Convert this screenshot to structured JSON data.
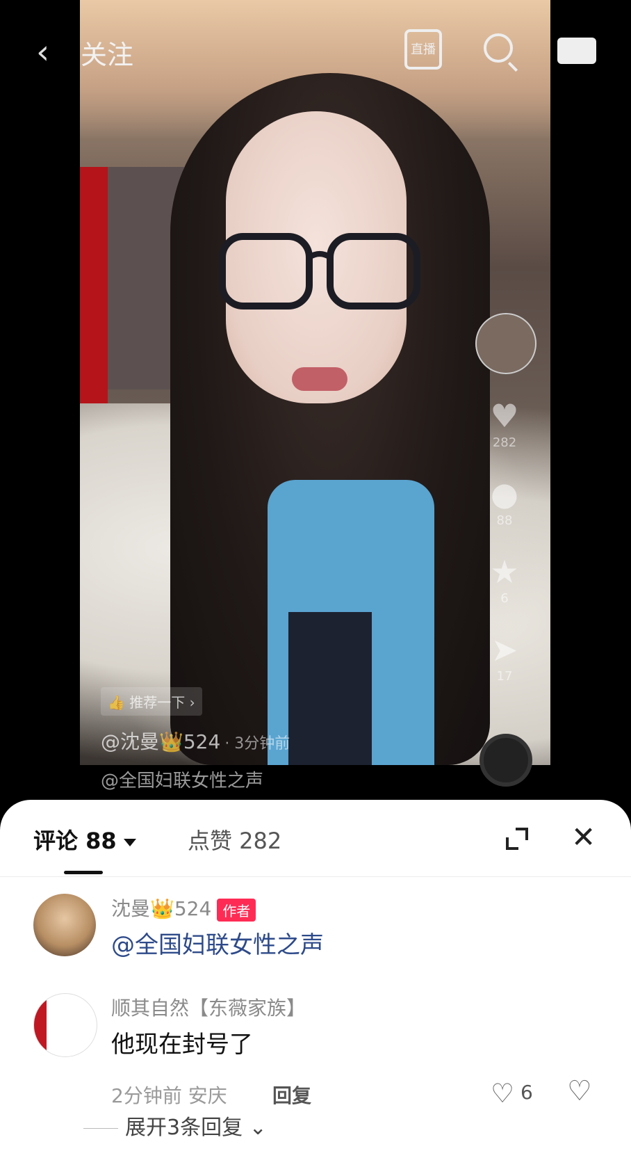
{
  "nav": {
    "follow_label": "关注",
    "live_label": "直播"
  },
  "video": {
    "recommend_label": "推荐一下",
    "author": "@沈曼👑524",
    "time": "· 3分钟前",
    "caption": "@全国妇联女性之声",
    "likes": "282",
    "comments": "88",
    "favorites": "6",
    "shares": "17"
  },
  "sheet": {
    "tab_comments": "评论 88",
    "tab_likes": "点赞 282"
  },
  "comments": [
    {
      "user": "沈曼👑524",
      "badge": "作者",
      "text": "@全国妇联女性之声"
    },
    {
      "user": "顺其自然【东薇家族】",
      "text": "他现在封号了",
      "meta": "2分钟前 安庆",
      "reply_label": "回复",
      "likes": "6"
    }
  ],
  "expand_replies_label": "展开3条回复"
}
